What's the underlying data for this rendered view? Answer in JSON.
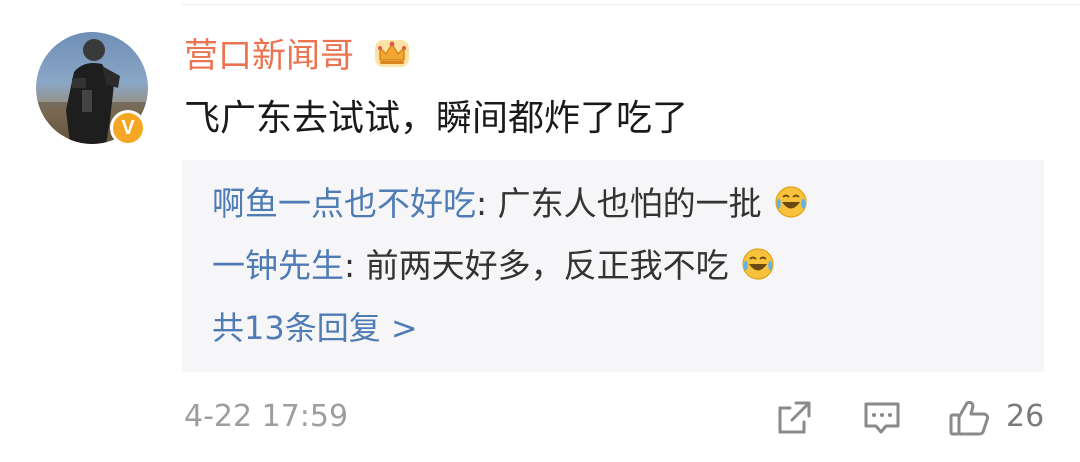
{
  "post": {
    "username": "营口新闻哥",
    "verified_badge": "V",
    "comment_text": "飞广东去试试，瞬间都炸了吃了",
    "timestamp": "4-22 17:59",
    "like_count": "26"
  },
  "replies": [
    {
      "author": "啊鱼一点也不好吃",
      "text": ": 广东人也怕的一批",
      "emoji": "laugh-cry-icon"
    },
    {
      "author": "一钟先生",
      "text": ": 前两天好多，反正我不吃",
      "emoji": "laugh-cry-icon"
    }
  ],
  "more_replies_label": "共13条回复 >",
  "colors": {
    "username": "#eb7350",
    "link": "#4f7cb5",
    "badge": "#f5a623",
    "replies_bg": "#f6f6f8",
    "meta": "#9e9e9e"
  },
  "icons": {
    "user_level": "crown-icon",
    "share": "share-icon",
    "comment": "comment-icon",
    "like": "thumbs-up-icon"
  }
}
